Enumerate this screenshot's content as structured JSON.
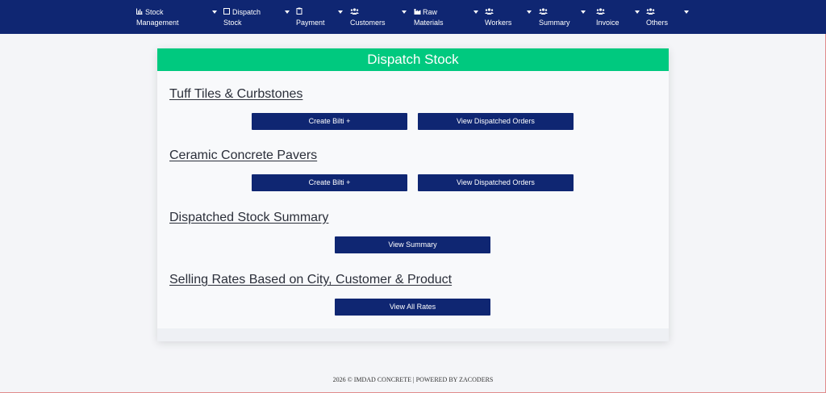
{
  "nav": {
    "stock_management": {
      "line1": "Stock",
      "line2": "Management",
      "icon": "chart-icon"
    },
    "dispatch_stock": {
      "line1": "Dispatch",
      "line2": "Stock",
      "icon": "box-icon"
    },
    "payment": {
      "line1": "Payment",
      "icon": "clipboard-icon"
    },
    "customers": {
      "line1": "Customers",
      "icon": "users-icon"
    },
    "raw_materials": {
      "line1": "Raw",
      "line2": "Materials",
      "icon": "factory-icon"
    },
    "workers": {
      "line1": "Workers",
      "icon": "users-icon"
    },
    "summary": {
      "line1": "Summary",
      "icon": "users-icon"
    },
    "invoice": {
      "line1": "Invoice",
      "icon": "users-icon"
    },
    "others": {
      "line1": "Others",
      "icon": "users-icon"
    }
  },
  "page": {
    "title": "Dispatch Stock",
    "sections": {
      "tuff": {
        "title": "Tuff Tiles & Curbstones",
        "create_label": "Create Bilti +",
        "view_label": "View Dispatched Orders"
      },
      "ceramic": {
        "title": "Ceramic Concrete Pavers",
        "create_label": "Create Bilti +",
        "view_label": "View Dispatched Orders"
      },
      "summary": {
        "title": "Dispatched Stock Summary",
        "view_label": "View Summary"
      },
      "rates": {
        "title": "Selling Rates Based on City, Customer & Product",
        "view_label": "View All Rates"
      }
    }
  },
  "footer": {
    "text": "2026 © IMDAD CONCRETE | POWERED BY ZACODERS"
  },
  "colors": {
    "navbar": "#0f2672",
    "header": "#00c97f",
    "button": "#0f2672"
  }
}
